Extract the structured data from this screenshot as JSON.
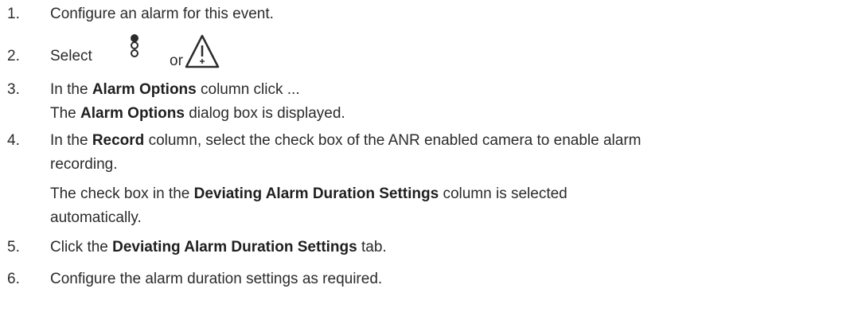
{
  "steps": [
    {
      "number": "1.",
      "text": "Configure an alarm for this event."
    },
    {
      "number": "2.",
      "pre": "Select",
      "mid": "or",
      "icons": [
        "alarm-indicator-stack-icon",
        "warning-triangle-icon"
      ]
    },
    {
      "number": "3.",
      "line1": {
        "pre": "In the ",
        "bold": "Alarm Options",
        "post": " column click ..."
      },
      "line2": {
        "pre": "The ",
        "bold": "Alarm Options",
        "post": " dialog box is displayed."
      }
    },
    {
      "number": "4.",
      "line1": {
        "pre": "In the ",
        "bold": "Record",
        "post": " column, select the check box of the ANR enabled camera to enable alarm"
      },
      "line2": "recording.",
      "line3": {
        "pre": "The check box in the ",
        "bold": "Deviating Alarm Duration Settings",
        "post": " column is selected"
      },
      "line4": "automatically."
    },
    {
      "number": "5.",
      "line1": {
        "pre": "Click the ",
        "bold": "Deviating Alarm Duration Settings",
        "post": " tab."
      }
    },
    {
      "number": "6.",
      "text": "Configure the alarm duration settings as required."
    }
  ]
}
